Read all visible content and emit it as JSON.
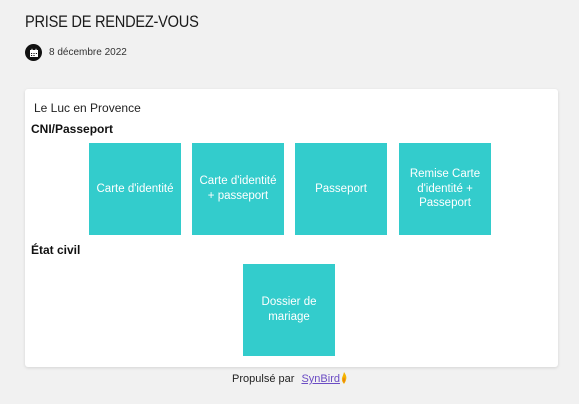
{
  "header": {
    "title": "PRISE DE RENDEZ-VOUS",
    "date": "8 décembre 2022",
    "date_icon": "calendar-icon"
  },
  "card": {
    "location": "Le Luc en Provence",
    "sections": [
      {
        "title": "CNI/Passeport",
        "tiles": [
          "Carte d'identité",
          "Carte d'identité + passeport",
          "Passeport",
          "Remise Carte d'identité + Passeport"
        ]
      },
      {
        "title": "État civil",
        "tiles": [
          "Dossier de mariage"
        ]
      }
    ]
  },
  "footer": {
    "prefix": "Propulsé par",
    "link": "SynBird",
    "link_icon": "flame-icon"
  },
  "colors": {
    "tile": "#33cccc",
    "background": "#f1f1f1",
    "link": "#6b4cc4"
  }
}
